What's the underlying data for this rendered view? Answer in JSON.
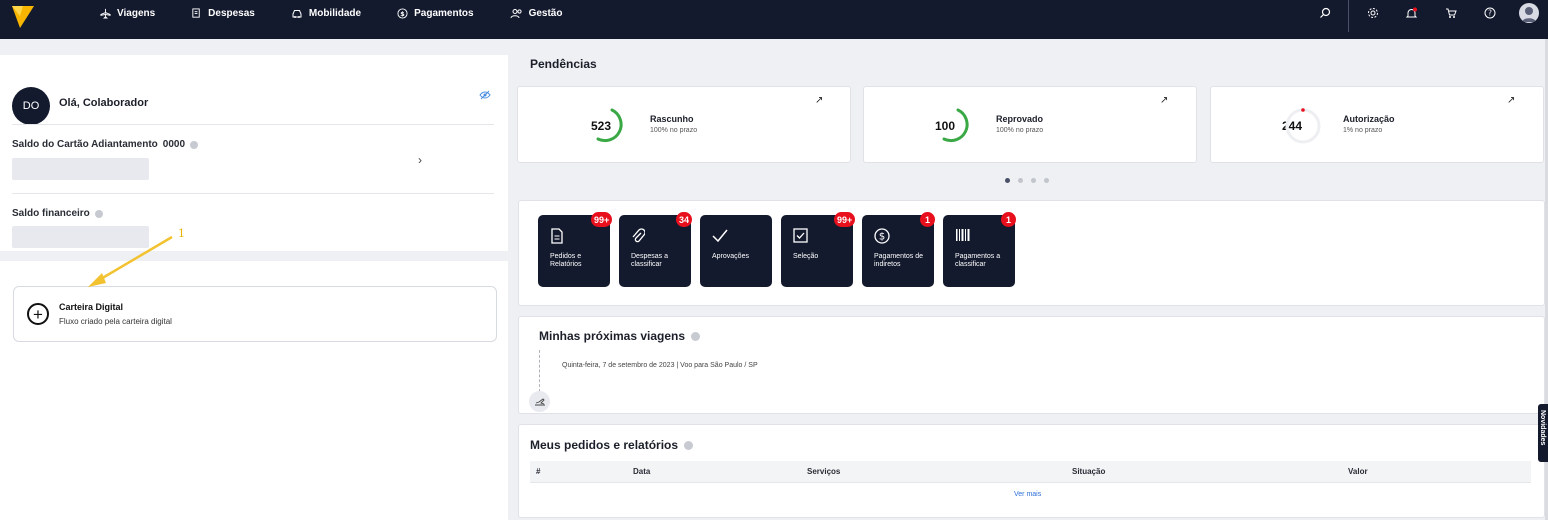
{
  "topbar": {
    "nav": [
      {
        "label": "Viagens",
        "icon": "airplane-icon"
      },
      {
        "label": "Despesas",
        "icon": "receipt-icon"
      },
      {
        "label": "Mobilidade",
        "icon": "car-icon"
      },
      {
        "label": "Pagamentos",
        "icon": "dollar-circle-icon"
      },
      {
        "label": "Gestão",
        "icon": "users-icon"
      }
    ],
    "right_icons": [
      "search-icon",
      "gear-icon",
      "bell-icon",
      "cart-icon",
      "help-icon",
      "user-avatar-icon"
    ]
  },
  "profile": {
    "initials": "DO",
    "greeting": "Olá, Colaborador",
    "saldo_cartao_label": "Saldo do Cartão Adiantamento",
    "saldo_cartao_number": "0000",
    "saldo_financeiro_label": "Saldo financeiro"
  },
  "carteira": {
    "title": "Carteira Digital",
    "subtitle": "Fluxo criado pela carteira digital"
  },
  "annotation": {
    "number": "1",
    "color": "#f2c230"
  },
  "pendencias": {
    "title": "Pendências",
    "cards": [
      {
        "count": "523",
        "label": "Rascunho",
        "sub": "100% no prazo",
        "progress": 0.75
      },
      {
        "count": "100",
        "label": "Reprovado",
        "sub": "100% no prazo",
        "progress": 0.75
      },
      {
        "count": "244",
        "label": "Autorização",
        "sub": "1% no prazo",
        "progress": 0.01
      }
    ],
    "carousel_pages": 4,
    "carousel_active": 0
  },
  "quick_actions": [
    {
      "label": "Pedidos e Relatórios",
      "badge": "99+",
      "icon": "document-icon"
    },
    {
      "label": "Despesas a classificar",
      "badge": "34",
      "icon": "paperclip-icon"
    },
    {
      "label": "Aprovações",
      "badge": "",
      "icon": "check-icon"
    },
    {
      "label": "Seleção",
      "badge": "99+",
      "icon": "checkbox-icon"
    },
    {
      "label": "Pagamentos de indiretos",
      "badge": "1",
      "icon": "dollar-circle-icon"
    },
    {
      "label": "Pagamentos a classificar",
      "badge": "1",
      "icon": "barcode-icon"
    }
  ],
  "viagens": {
    "title": "Minhas próximas viagens",
    "trip": "Quinta-feira, 7 de setembro de 2023 | Voo para São Paulo / SP"
  },
  "pedidos": {
    "title": "Meus pedidos e relatórios",
    "columns": [
      "#",
      "Data",
      "Serviços",
      "Situação",
      "Valor"
    ],
    "ver_mais": "Ver mais"
  },
  "side_tab": {
    "label": "Novidades"
  },
  "colors": {
    "navy": "#141a2e",
    "green": "#3aa845",
    "red": "#e8101c",
    "link": "#2d6fd6"
  }
}
